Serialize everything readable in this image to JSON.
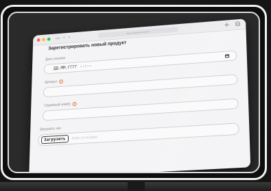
{
  "browser": {
    "address": "tilda.ru/page/new-product",
    "new_tab_icon": "plus-icon",
    "tabs_icon": "tabs-icon",
    "nav_icons": [
      "sidebar-icon",
      "back-icon",
      "forward-icon"
    ]
  },
  "form": {
    "title": "Зарегистрировать новый продукт",
    "purchase_date": {
      "label": "Дата покупки",
      "value": "ДД.ММ.ГГГГ --:--"
    },
    "article": {
      "label": "Артикул",
      "value": ""
    },
    "serial": {
      "label": "Серийный номер",
      "value": ""
    },
    "receipt": {
      "label": "Загрузить чек",
      "button_label": "Загрузить",
      "hint": "Файл не выбран"
    }
  },
  "colors": {
    "warning": "#ea6a2a",
    "frame": "#f2f2f2",
    "window_bg": "#f4f4f6"
  }
}
